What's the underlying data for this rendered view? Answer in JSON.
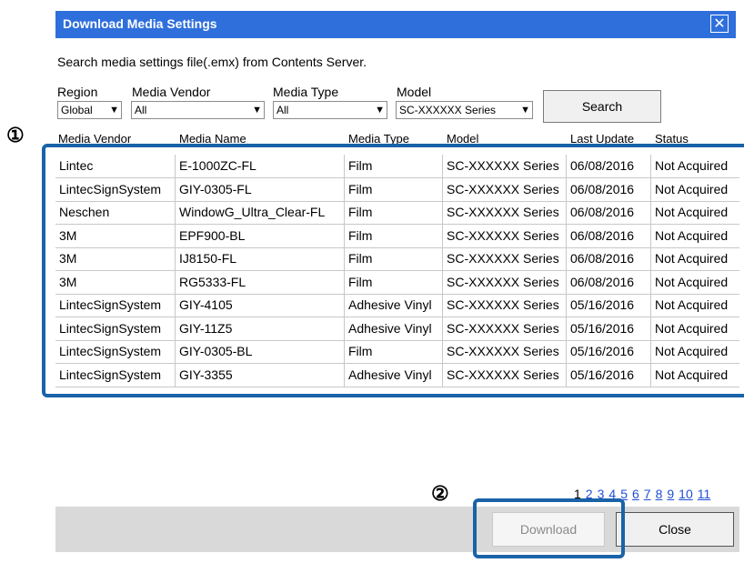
{
  "dialog": {
    "title": "Download Media Settings",
    "close_glyph": "✕",
    "description": "Search media settings file(.emx) from Contents Server."
  },
  "filters": {
    "region": {
      "label": "Region",
      "value": "Global"
    },
    "vendor": {
      "label": "Media Vendor",
      "value": "All"
    },
    "type": {
      "label": "Media Type",
      "value": "All"
    },
    "model": {
      "label": "Model",
      "value": "SC-XXXXXX Series"
    },
    "search_label": "Search"
  },
  "callouts": {
    "one": "①",
    "two": "②"
  },
  "table": {
    "headers": [
      "Media Vendor",
      "Media Name",
      "Media Type",
      "Model",
      "Last Update",
      "Status"
    ],
    "rows": [
      [
        "Lintec",
        "E-1000ZC-FL",
        "Film",
        "SC-XXXXXX Series",
        "06/08/2016",
        "Not Acquired"
      ],
      [
        "LintecSignSystem",
        "GIY-0305-FL",
        "Film",
        "SC-XXXXXX Series",
        "06/08/2016",
        "Not Acquired"
      ],
      [
        "Neschen",
        "WindowG_Ultra_Clear-FL",
        "Film",
        "SC-XXXXXX Series",
        "06/08/2016",
        "Not Acquired"
      ],
      [
        "3M",
        "EPF900-BL",
        "Film",
        "SC-XXXXXX Series",
        "06/08/2016",
        "Not Acquired"
      ],
      [
        "3M",
        "IJ8150-FL",
        "Film",
        "SC-XXXXXX Series",
        "06/08/2016",
        "Not Acquired"
      ],
      [
        "3M",
        "RG5333-FL",
        "Film",
        "SC-XXXXXX Series",
        "06/08/2016",
        "Not Acquired"
      ],
      [
        "LintecSignSystem",
        "GIY-4105",
        "Adhesive Vinyl",
        "SC-XXXXXX Series",
        "05/16/2016",
        "Not Acquired"
      ],
      [
        "LintecSignSystem",
        "GIY-11Z5",
        "Adhesive Vinyl",
        "SC-XXXXXX Series",
        "05/16/2016",
        "Not Acquired"
      ],
      [
        "LintecSignSystem",
        "GIY-0305-BL",
        "Film",
        "SC-XXXXXX Series",
        "05/16/2016",
        "Not Acquired"
      ],
      [
        "LintecSignSystem",
        "GIY-3355",
        "Adhesive Vinyl",
        "SC-XXXXXX Series",
        "05/16/2016",
        "Not Acquired"
      ]
    ]
  },
  "pagination": {
    "pages": [
      "1",
      "2",
      "3",
      "4",
      "5",
      "6",
      "7",
      "8",
      "9",
      "10",
      "11"
    ],
    "current": "1"
  },
  "buttons": {
    "download_label": "Download",
    "close_label": "Close"
  },
  "colors": {
    "title_bar": "#2f6fdc",
    "callout_border": "#1a63a8",
    "link": "#1f4fd6"
  }
}
